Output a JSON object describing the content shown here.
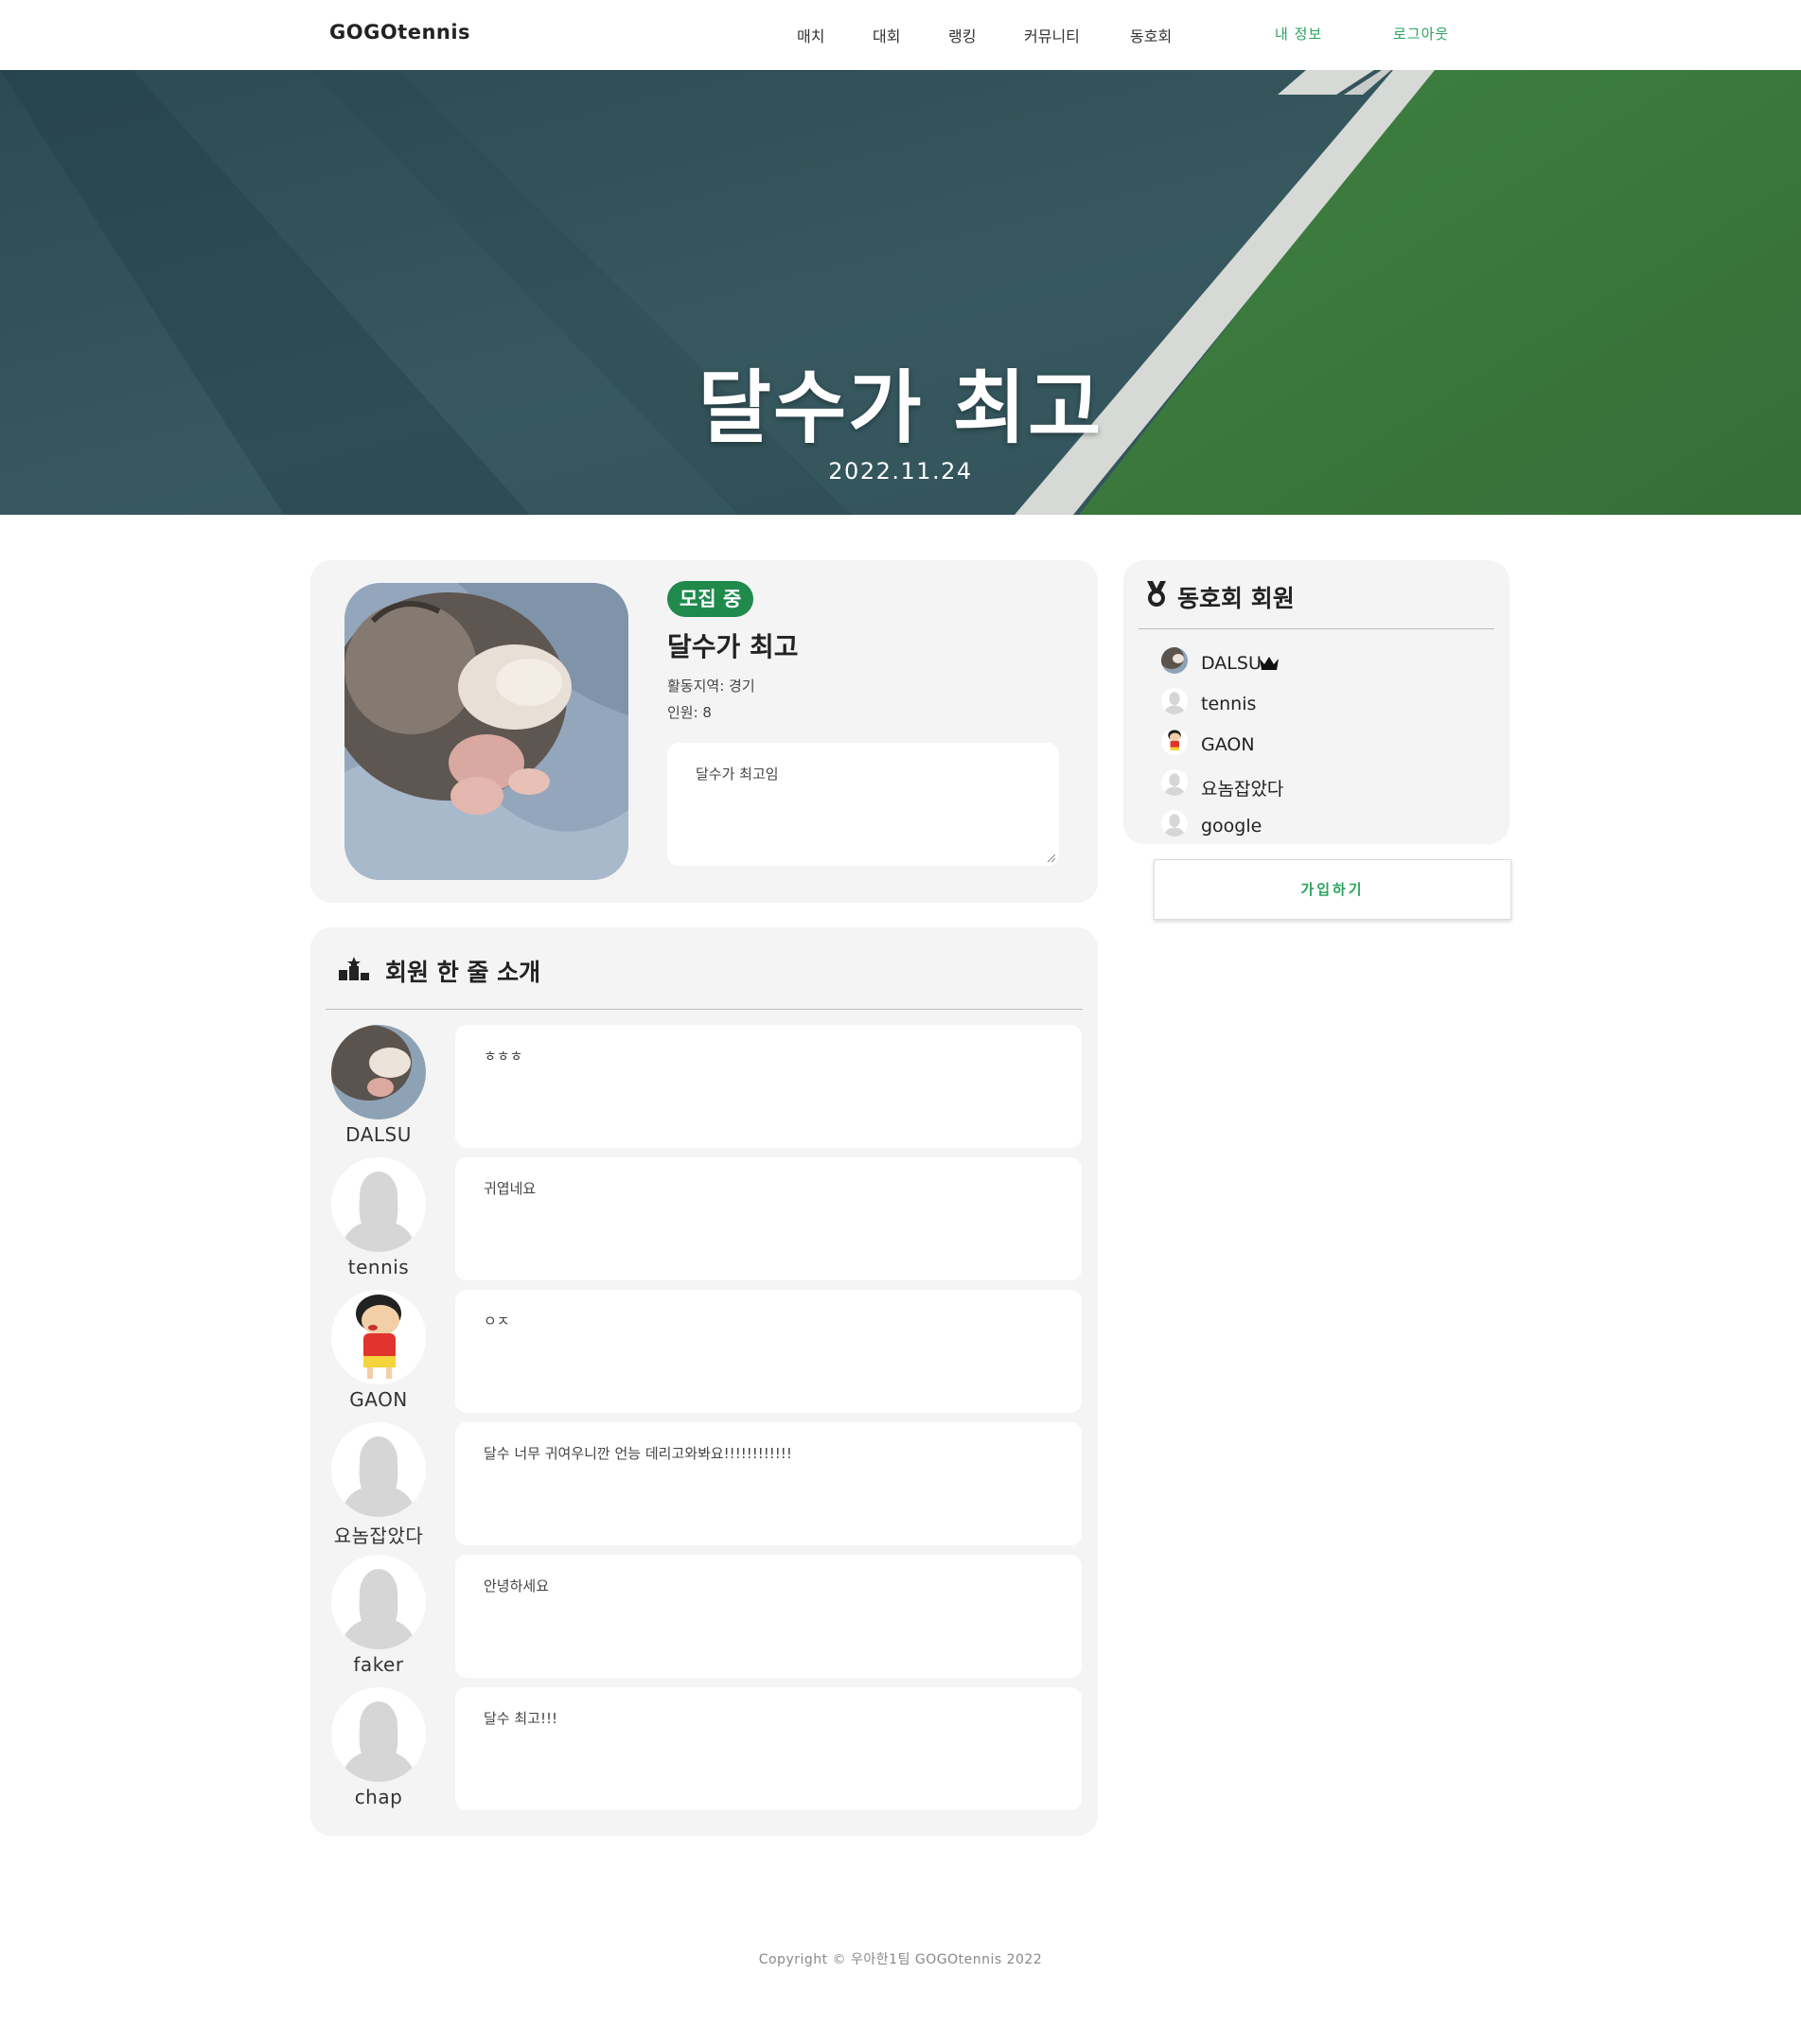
{
  "nav": {
    "logo": "GOGOtennis",
    "menu": [
      "매치",
      "대회",
      "랭킹",
      "커뮤니티",
      "동호회"
    ],
    "my_info": "내 정보",
    "logout": "로그아웃"
  },
  "hero": {
    "title": "달수가 최고",
    "date": "2022.11.24"
  },
  "club": {
    "status": "모집 중",
    "name": "달수가 최고",
    "region": "활동지역: 경기",
    "headcount": "인원: 8",
    "description": "달수가 최고임"
  },
  "intro": {
    "title": "회원 한 줄 소개",
    "rows": [
      {
        "name": "DALSU",
        "message": "ㅎㅎㅎ",
        "avatar": "photo"
      },
      {
        "name": "tennis",
        "message": "귀엽네요",
        "avatar": "default"
      },
      {
        "name": "GAON",
        "message": "ㅇㅈ",
        "avatar": "cartoon"
      },
      {
        "name": "요놈잡았다",
        "message": "달수 너무 귀여우니깐 언능 데리고와봐요!!!!!!!!!!!!",
        "avatar": "default"
      },
      {
        "name": "faker",
        "message": "안녕하세요",
        "avatar": "default"
      },
      {
        "name": "chap",
        "message": "달수 최고!!!",
        "avatar": "default"
      }
    ]
  },
  "members": {
    "title": "동호회 회원",
    "list": [
      {
        "name": "DALSU",
        "avatar": "photo",
        "leader": true
      },
      {
        "name": "tennis",
        "avatar": "default",
        "leader": false
      },
      {
        "name": "GAON",
        "avatar": "cartoon",
        "leader": false
      },
      {
        "name": "요놈잡았다",
        "avatar": "default",
        "leader": false
      },
      {
        "name": "google",
        "avatar": "default",
        "leader": false
      }
    ],
    "join_label": "가입하기"
  },
  "footer": "Copyright © 우아한1팀 GOGOtennis 2022",
  "colors": {
    "accent": "#2aa35f",
    "badge": "#1f8a4c",
    "card_bg": "#f4f4f4",
    "court_blue": "#33545c",
    "court_green": "#3a7a3f"
  }
}
